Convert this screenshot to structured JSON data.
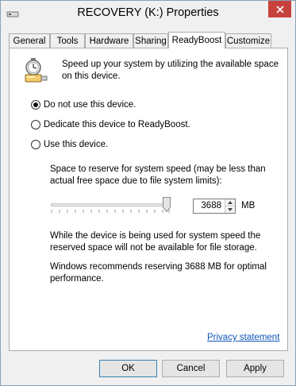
{
  "window": {
    "title": "RECOVERY (K:) Properties",
    "close_glyph": "✕",
    "accent_close": "#c7413d"
  },
  "tabs": [
    {
      "label": "General",
      "active": false
    },
    {
      "label": "Tools",
      "active": false
    },
    {
      "label": "Hardware",
      "active": false
    },
    {
      "label": "Sharing",
      "active": false
    },
    {
      "label": "ReadyBoost",
      "active": true
    },
    {
      "label": "Customize",
      "active": false
    }
  ],
  "readyboost": {
    "icon": "readyboost-stopwatch-usb-icon",
    "description": "Speed up your system by utilizing the available space on this device.",
    "options": [
      {
        "label": "Do not use this device.",
        "checked": true
      },
      {
        "label": "Dedicate this device to ReadyBoost.",
        "checked": false
      },
      {
        "label": "Use this device.",
        "checked": false
      }
    ],
    "reserve_label": "Space to reserve for system speed (may be less than actual free space due to file system limits):",
    "slider_level_fraction": 0.95,
    "reserve_value": "3688",
    "reserve_unit": "MB",
    "info_text": "While the device is being used for system speed the reserved space will not be available for file storage.",
    "recommend_text": "Windows recommends reserving 3688 MB for optimal performance.",
    "privacy_link": "Privacy statement"
  },
  "buttons": {
    "ok": "OK",
    "cancel": "Cancel",
    "apply": "Apply"
  }
}
